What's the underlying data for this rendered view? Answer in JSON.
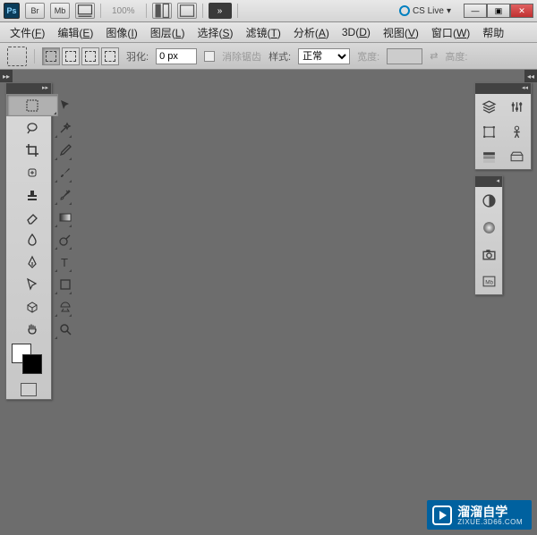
{
  "titlebar": {
    "br": "Br",
    "mb": "Mb",
    "zoom": "100%",
    "cslive": "CS Live"
  },
  "menu": {
    "file": "文件",
    "file_k": "F",
    "edit": "编辑",
    "edit_k": "E",
    "image": "图像",
    "image_k": "I",
    "layer": "图层",
    "layer_k": "L",
    "select": "选择",
    "select_k": "S",
    "filter": "滤镜",
    "filter_k": "T",
    "analysis": "分析",
    "analysis_k": "A",
    "three_d": "3D",
    "three_d_k": "D",
    "view": "视图",
    "view_k": "V",
    "window": "窗口",
    "window_k": "W",
    "help": "帮助"
  },
  "options": {
    "feather_label": "羽化:",
    "feather_value": "0 px",
    "antialias": "消除锯齿",
    "style_label": "样式:",
    "style_value": "正常",
    "width_label": "宽度:",
    "height_label": "高度:"
  },
  "watermark": {
    "title": "溜溜自学",
    "sub": "ZIXUE.3D66.COM"
  }
}
